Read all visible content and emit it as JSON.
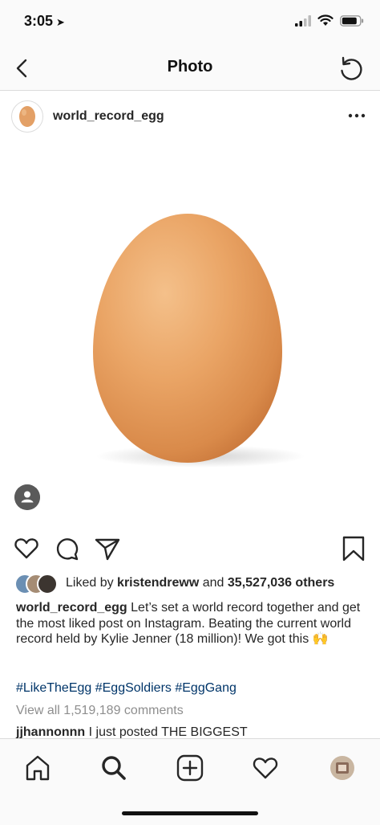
{
  "status_bar": {
    "time": "3:05"
  },
  "nav": {
    "title": "Photo"
  },
  "post": {
    "username": "world_record_egg",
    "likes": {
      "prefix": "Liked by ",
      "user": "kristendreww",
      "middle": " and ",
      "count": "35,527,036 others"
    },
    "caption": {
      "username": "world_record_egg",
      "text": " Let’s set a world record together and get the most liked post on Instagram. Beating the current world record held by Kylie Jenner (18 million)! We got this 🙌"
    },
    "hashtags": "#LikeTheEgg #EggSoldiers #EggGang",
    "view_all_comments": "View all 1,519,189 comments",
    "first_comment": {
      "username": "jjhannonnn",
      "text": " I just posted THE BIGGEST"
    }
  },
  "colors": {
    "hashtag": "#003569",
    "muted": "#8e8e8e",
    "text": "#262626",
    "egg": "#e8a263"
  },
  "icons": [
    "location-arrow-icon",
    "signal-icon",
    "wifi-icon",
    "battery-icon",
    "back-chevron-icon",
    "refresh-icon",
    "more-dots-icon",
    "user-tag-icon",
    "heart-icon",
    "comment-icon",
    "share-icon",
    "bookmark-icon",
    "home-icon",
    "search-icon",
    "add-post-icon",
    "activity-heart-icon",
    "profile-avatar-icon"
  ]
}
